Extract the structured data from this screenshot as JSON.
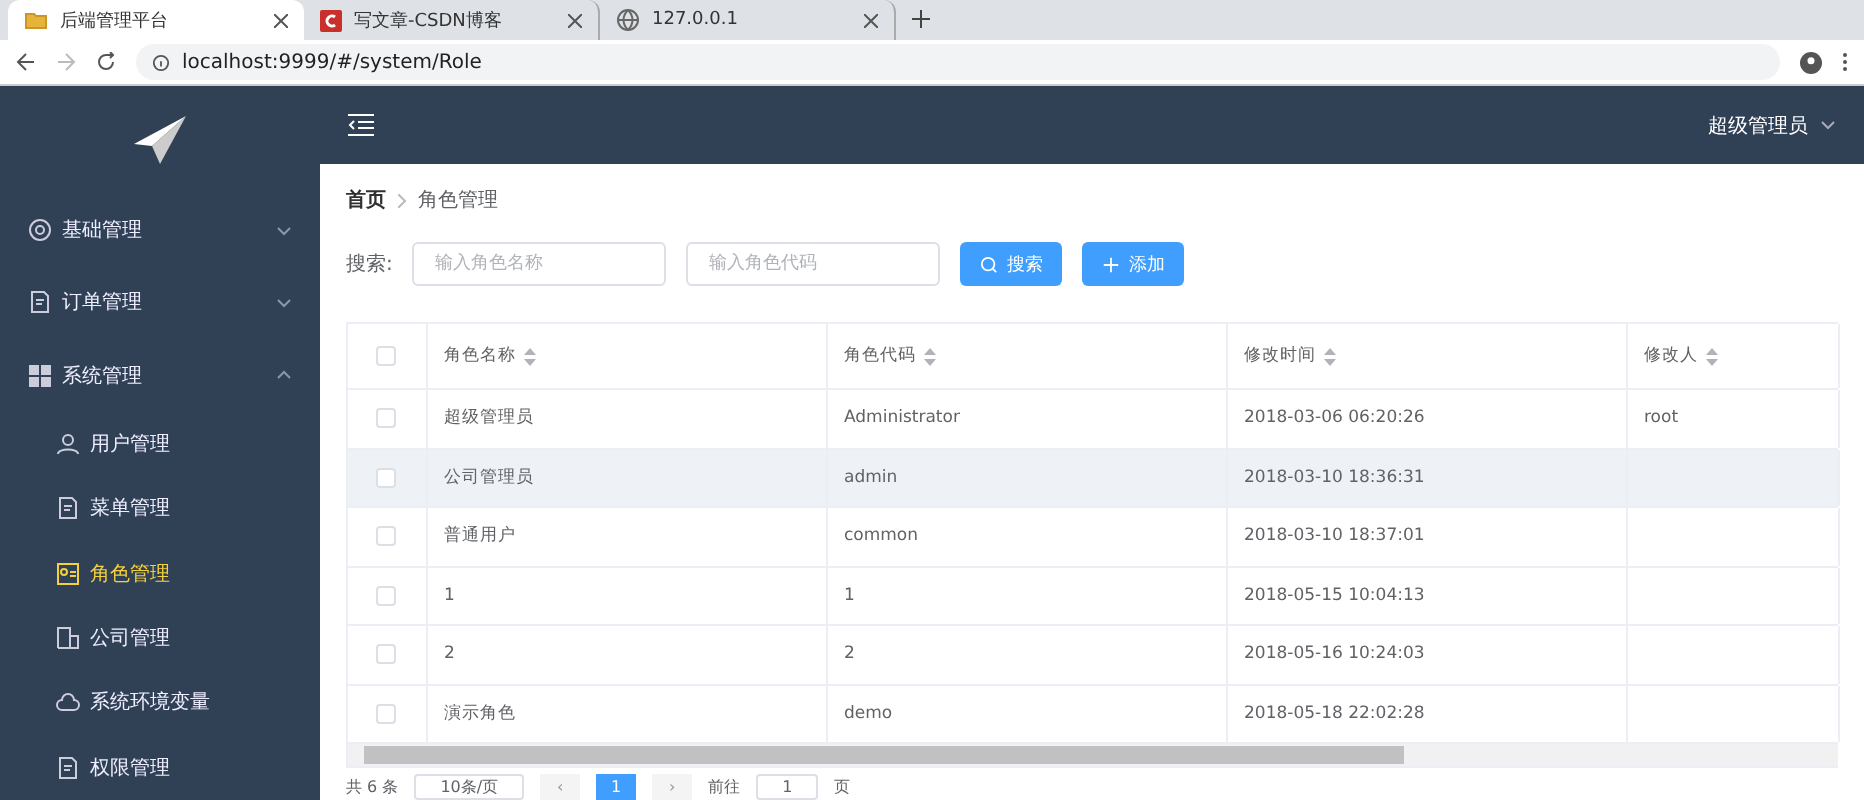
{
  "browser": {
    "tabs": [
      {
        "title": "后端管理平台",
        "selected": true
      },
      {
        "title": "写文章-CSDN博客",
        "selected": false
      },
      {
        "title": "127.0.0.1",
        "selected": false
      }
    ],
    "address": "localhost:9999/#/system/Role"
  },
  "sidebar": {
    "items": [
      {
        "label": "基础管理",
        "expanded": false
      },
      {
        "label": "订单管理",
        "expanded": false
      },
      {
        "label": "系统管理",
        "expanded": true,
        "children": [
          {
            "label": "用户管理",
            "selected": false
          },
          {
            "label": "菜单管理",
            "selected": false
          },
          {
            "label": "角色管理",
            "selected": true
          },
          {
            "label": "公司管理",
            "selected": false
          },
          {
            "label": "系统环境变量",
            "selected": false
          },
          {
            "label": "权限管理",
            "selected": false
          }
        ]
      }
    ]
  },
  "header": {
    "user": "超级管理员"
  },
  "breadcrumb": [
    "首页",
    "角色管理"
  ],
  "search": {
    "label": "搜索:",
    "fields": [
      {
        "placeholder": "输入角色名称"
      },
      {
        "placeholder": "输入角色代码"
      }
    ],
    "buttons": [
      {
        "label": "搜索",
        "kind": "search"
      },
      {
        "label": "添加",
        "kind": "add"
      }
    ]
  },
  "table": {
    "select_all_checked": false,
    "columns": [
      "角色名称",
      "角色代码",
      "修改时间",
      "修改人"
    ],
    "rows": [
      {
        "cells": [
          "超级管理员",
          "Administrator",
          "2018-03-06 06:20:26",
          "root"
        ],
        "checked": false,
        "hovered": false
      },
      {
        "cells": [
          "公司管理员",
          "admin",
          "2018-03-10 18:36:31",
          ""
        ],
        "checked": false,
        "hovered": true
      },
      {
        "cells": [
          "普通用户",
          "common",
          "2018-03-10 18:37:01",
          ""
        ],
        "checked": false,
        "hovered": false
      },
      {
        "cells": [
          "1",
          "1",
          "2018-05-15 10:04:13",
          ""
        ],
        "checked": false,
        "hovered": false
      },
      {
        "cells": [
          "2",
          "2",
          "2018-05-16 10:24:03",
          ""
        ],
        "checked": false,
        "hovered": false
      },
      {
        "cells": [
          "演示角色",
          "demo",
          "2018-05-18 22:02:28",
          ""
        ],
        "checked": false,
        "hovered": false
      }
    ]
  },
  "pagination": {
    "total": "共 6 条",
    "page_size": "10条/页",
    "prev": "‹",
    "pages": [
      {
        "label": "1",
        "selected": true
      }
    ],
    "next": "›",
    "goto_label": "前往",
    "goto_value": "1",
    "goto_suffix": "页"
  }
}
